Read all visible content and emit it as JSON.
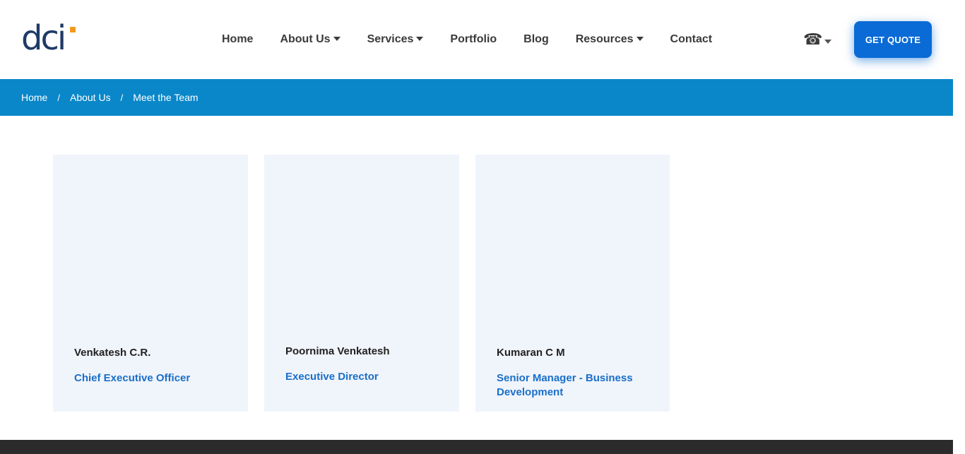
{
  "logo": {
    "text": "dci"
  },
  "nav": {
    "items": [
      {
        "label": "Home",
        "dropdown": false
      },
      {
        "label": "About Us",
        "dropdown": true
      },
      {
        "label": "Services",
        "dropdown": true
      },
      {
        "label": "Portfolio",
        "dropdown": false
      },
      {
        "label": "Blog",
        "dropdown": false
      },
      {
        "label": "Resources",
        "dropdown": true
      },
      {
        "label": "Contact",
        "dropdown": false
      }
    ]
  },
  "phone": {
    "icon": "phone-icon"
  },
  "cta": {
    "label": "GET QUOTE"
  },
  "breadcrumb": {
    "items": [
      "Home",
      "About Us",
      "Meet the Team"
    ],
    "separator": "/"
  },
  "team": [
    {
      "name": "Venkatesh C.R.",
      "role": "Chief Executive Officer"
    },
    {
      "name": "Poornima Venkatesh",
      "role": "Executive Director"
    },
    {
      "name": "Kumaran C M",
      "role": "Senior Manager - Business Development"
    }
  ],
  "colors": {
    "brand_blue": "#0a6bd6",
    "breadcrumb_bg": "#0a87c9",
    "logo_navy": "#1f3a68",
    "logo_accent": "#f29a1e",
    "card_bg": "#f0f4fb",
    "role_text": "#1a6fc9",
    "footer_bg": "#2b2b2b"
  }
}
